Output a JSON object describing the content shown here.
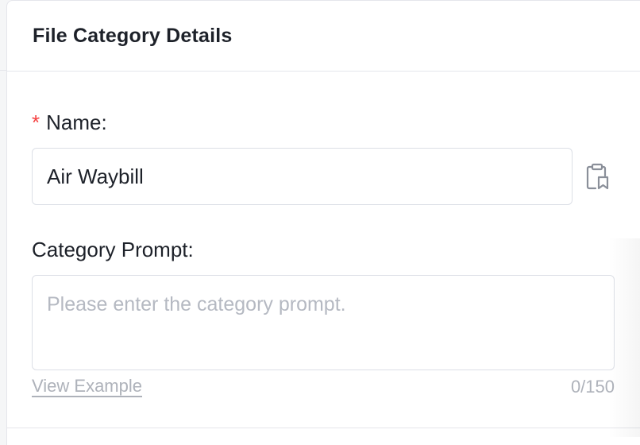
{
  "header": {
    "title": "File Category Details"
  },
  "form": {
    "name": {
      "required_mark": "*",
      "label": "Name:",
      "value": "Air Waybill"
    },
    "category_prompt": {
      "label": "Category Prompt:",
      "placeholder": "Please enter the category prompt.",
      "value": "",
      "view_example_label": "View Example",
      "char_count": "0/150"
    }
  },
  "icons": {
    "name_field_action": "clipboard-bookmark-icon"
  },
  "colors": {
    "required": "#f53f3f",
    "text": "#1d2129",
    "muted": "#aeb2ba",
    "border": "#dcdfe6"
  }
}
